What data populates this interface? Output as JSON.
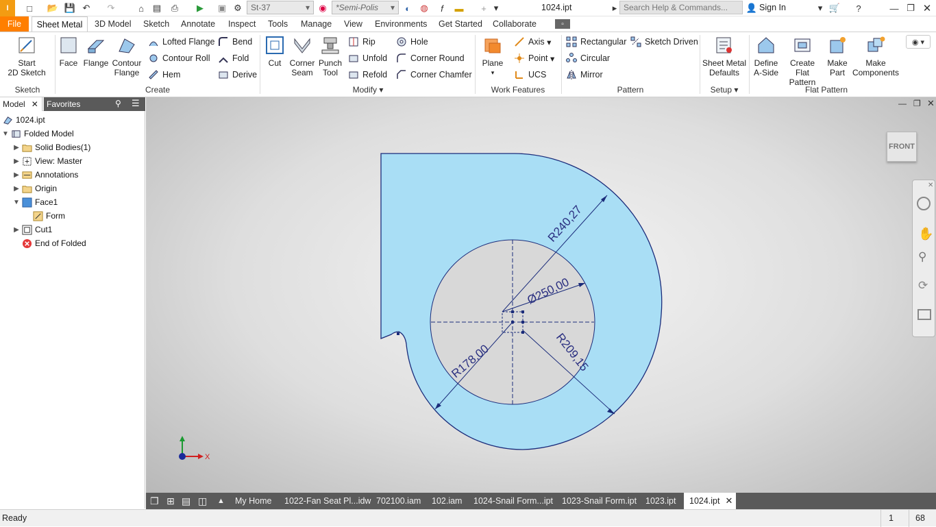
{
  "titlebar": {
    "material": "St-37",
    "appearance": "*Semi-Polis",
    "doc_title": "1024.ipt",
    "search_placeholder": "Search Help & Commands...",
    "sign_in": "Sign In"
  },
  "tabs": [
    "File",
    "Sheet Metal",
    "3D Model",
    "Sketch",
    "Annotate",
    "Inspect",
    "Tools",
    "Manage",
    "View",
    "Environments",
    "Get Started",
    "Collaborate"
  ],
  "ribbon": {
    "sketch": {
      "start_l1": "Start",
      "start_l2": "2D Sketch",
      "title": "Sketch"
    },
    "create": {
      "face": "Face",
      "flange": "Flange",
      "contour_l1": "Contour",
      "contour_l2": "Flange",
      "lofted": "Lofted Flange",
      "contour_roll": "Contour Roll",
      "hem": "Hem",
      "bend": "Bend",
      "fold": "Fold",
      "derive": "Derive",
      "title": "Create"
    },
    "modify": {
      "cut": "Cut",
      "corner_l1": "Corner",
      "corner_l2": "Seam",
      "punch_l1": "Punch",
      "punch_l2": "Tool",
      "rip": "Rip",
      "unfold": "Unfold",
      "refold": "Refold",
      "hole": "Hole",
      "corner_round": "Corner Round",
      "corner_chamfer": "Corner Chamfer",
      "title": "Modify"
    },
    "work": {
      "plane": "Plane",
      "axis": "Axis",
      "point": "Point",
      "ucs": "UCS",
      "title": "Work Features"
    },
    "pattern": {
      "rect": "Rectangular",
      "circ": "Circular",
      "mirror": "Mirror",
      "sketch_driven": "Sketch Driven",
      "title": "Pattern"
    },
    "setup": {
      "defaults_l1": "Sheet Metal",
      "defaults_l2": "Defaults",
      "title": "Setup"
    },
    "flat": {
      "define_l1": "Define",
      "define_l2": "A-Side",
      "create_l1": "Create",
      "create_l2": "Flat Pattern",
      "make_part_l1": "Make",
      "make_part_l2": "Part",
      "make_comp_l1": "Make",
      "make_comp_l2": "Components",
      "title": "Flat Pattern"
    }
  },
  "browser": {
    "tab_model": "Model",
    "tab_favorites": "Favorites",
    "items": [
      {
        "label": "1024.ipt",
        "icon": "part-icon"
      },
      {
        "label": "Folded Model",
        "icon": "folded-model-icon"
      },
      {
        "label": "Solid Bodies(1)",
        "icon": "folder-icon"
      },
      {
        "label": "View: Master",
        "icon": "view-icon"
      },
      {
        "label": "Annotations",
        "icon": "annotation-icon"
      },
      {
        "label": "Origin",
        "icon": "folder-icon"
      },
      {
        "label": "Face1",
        "icon": "face-icon"
      },
      {
        "label": "Form",
        "icon": "sketch-icon"
      },
      {
        "label": "Cut1",
        "icon": "cut-icon"
      },
      {
        "label": "End of Folded",
        "icon": "end-icon"
      }
    ]
  },
  "viewport": {
    "viewcube": "FRONT",
    "dims": {
      "r1": "R240,27",
      "d1": "Ø250,00",
      "r2": "R209,15",
      "r3": "R178,00"
    },
    "axis_x": "X",
    "colors": {
      "part_fill": "#a9def5",
      "part_edge": "#1a2b7a",
      "dim_text": "#2a2f80"
    }
  },
  "doctabs": [
    "My Home",
    "1022-Fan Seat Pl...idw",
    "702100.iam",
    "102.iam",
    "1024-Snail Form...ipt",
    "1023-Snail Form.ipt",
    "1023.ipt",
    "1024.ipt"
  ],
  "status": {
    "text": "Ready",
    "n1": "1",
    "n2": "68"
  }
}
